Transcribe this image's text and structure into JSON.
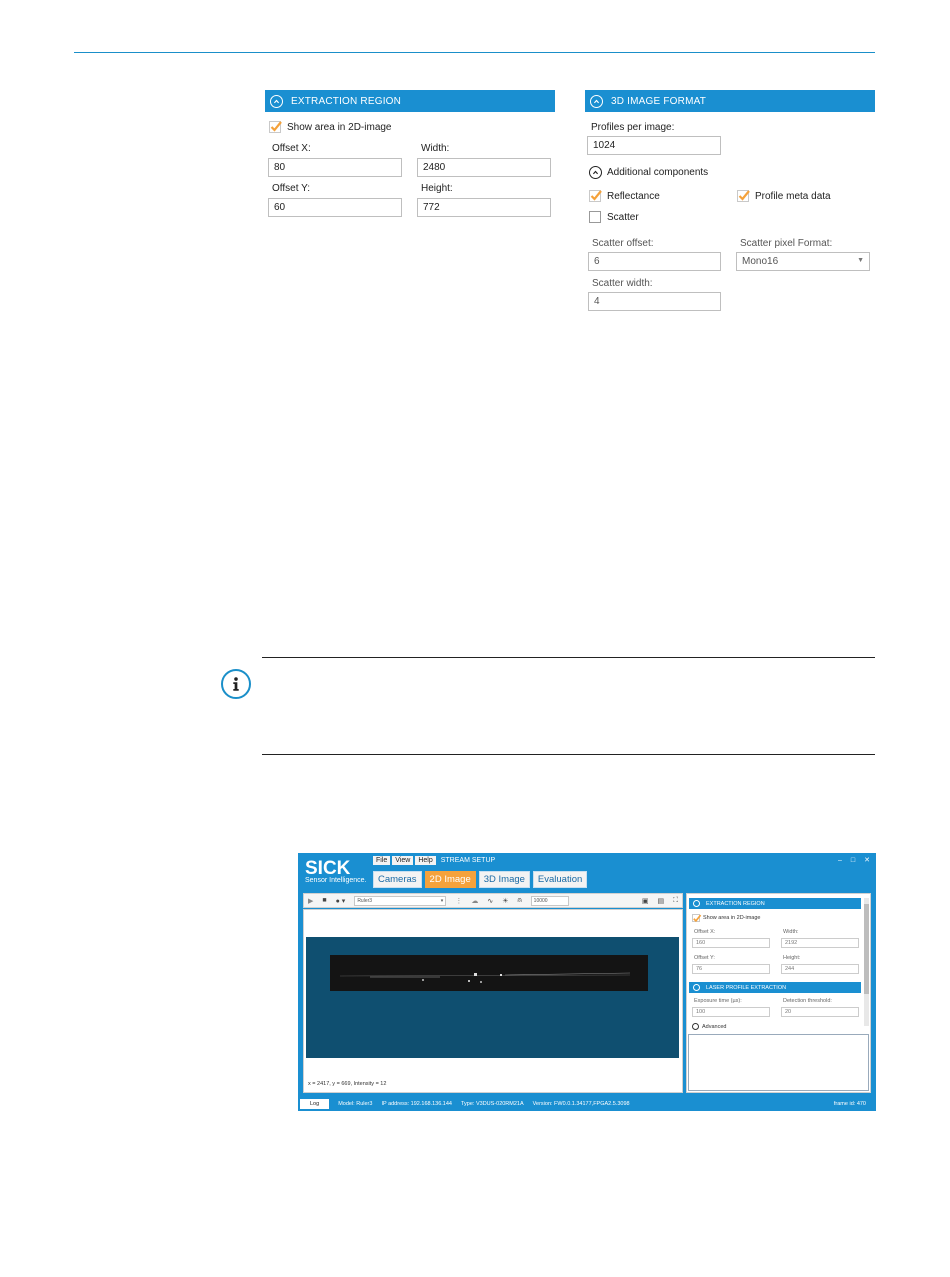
{
  "extraction_region": {
    "title": "EXTRACTION REGION",
    "show_area_label": "Show area in 2D-image",
    "offset_x_label": "Offset X:",
    "offset_x": "80",
    "width_label": "Width:",
    "width": "2480",
    "offset_y_label": "Offset Y:",
    "offset_y": "60",
    "height_label": "Height:",
    "height": "772"
  },
  "image_format": {
    "title": "3D IMAGE FORMAT",
    "profiles_label": "Profiles per image:",
    "profiles": "1024",
    "additional_label": "Additional components",
    "reflectance_label": "Reflectance",
    "meta_label": "Profile meta data",
    "scatter_label": "Scatter",
    "scatter_offset_label": "Scatter offset:",
    "scatter_offset": "6",
    "scatter_format_label": "Scatter pixel Format:",
    "scatter_format": "Mono16",
    "scatter_width_label": "Scatter width:",
    "scatter_width": "4"
  },
  "app": {
    "logo": "SICK",
    "logo_sub": "Sensor Intelligence.",
    "menu": [
      "File",
      "View",
      "Help"
    ],
    "stream_setup": "STREAM SETUP",
    "tabs": [
      "Cameras",
      "2D Image",
      "3D Image",
      "Evaluation"
    ],
    "camera_select": "Ruler3",
    "counter": "10000",
    "coords": "x = 2417, y = 669, Intensity = 12",
    "panel": {
      "extraction_title": "EXTRACTION REGION",
      "show_area": "Show area in 2D-image",
      "offset_x_label": "Offset X:",
      "offset_x": "160",
      "width_label": "Width:",
      "width": "2192",
      "offset_y_label": "Offset Y:",
      "offset_y": "76",
      "height_label": "Height:",
      "height": "244",
      "laser_title": "LASER PROFILE EXTRACTION",
      "exposure_label": "Exposure time (µs):",
      "exposure": "100",
      "threshold_label": "Detection threshold:",
      "threshold": "20",
      "advanced": "Advanced"
    },
    "status": {
      "log": "Log",
      "model": "Model: Ruler3",
      "ip": "IP address: 192.168.136.144",
      "type": "Type: V3DUS-020RM21A",
      "version": "Version: FW0.0.1.34177,FPGA2.5.3098",
      "frame": "frame id: 470"
    }
  },
  "colors": {
    "accent": "#1a8fd1",
    "check": "#f5a23b"
  }
}
